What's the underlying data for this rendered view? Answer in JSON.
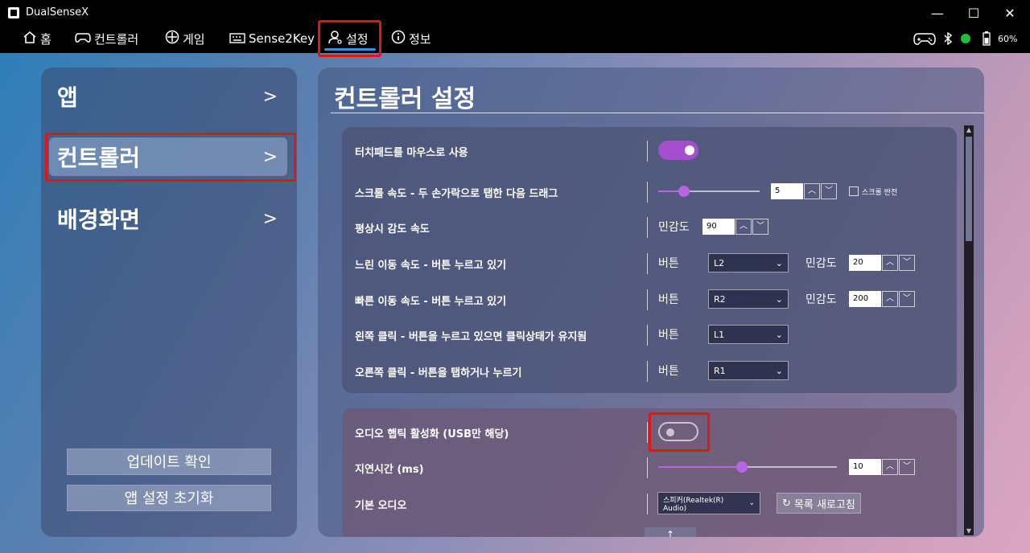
{
  "app": {
    "title": "DualSenseX"
  },
  "window": {
    "minimize": "—",
    "maximize": "☐",
    "close": "✕"
  },
  "nav": {
    "items": [
      {
        "label": "홈",
        "icon": "home-icon"
      },
      {
        "label": "컨트롤러",
        "icon": "gamepad-icon"
      },
      {
        "label": "게임",
        "icon": "games-icon"
      },
      {
        "label": "Sense2Key",
        "icon": "keyboard-icon"
      },
      {
        "label": "설정",
        "icon": "user-settings-icon",
        "active": true
      },
      {
        "label": "정보",
        "icon": "info-icon"
      }
    ],
    "battery": "60%"
  },
  "sidebar": {
    "items": [
      {
        "label": "앱",
        "chevron": ">"
      },
      {
        "label": "컨트롤러",
        "chevron": ">",
        "active": true
      },
      {
        "label": "배경화면",
        "chevron": ">"
      }
    ],
    "update_button": "업데이트 확인",
    "reset_button": "앱 설정 초기화"
  },
  "main": {
    "title": "컨트롤러 설정",
    "touchpad_mouse": {
      "label": "터치패드를 마우스로 사용",
      "enabled": true
    },
    "scroll_speed": {
      "label": "스크롤 속도 - 두 손가락으로 탭한 다음 드래그",
      "value": "5",
      "level": 0.25,
      "invert_label": "스크롤 반전",
      "invert_checked": false
    },
    "normal_sensitivity": {
      "label": "평상시 감도 속도",
      "sens_label": "민감도",
      "value": "90"
    },
    "slow_move": {
      "label": "느린 이동 속도 - 버튼 누르고 있기",
      "button_label": "버튼",
      "button_value": "L2",
      "sens_label": "민감도",
      "sens_value": "20"
    },
    "fast_move": {
      "label": "빠른 이동 속도 - 버튼 누르고 있기",
      "button_label": "버튼",
      "button_value": "R2",
      "sens_label": "민감도",
      "sens_value": "200"
    },
    "left_click": {
      "label": "왼쪽 클릭 - 버튼을 누르고 있으면 클릭상태가 유지됨",
      "button_label": "버튼",
      "button_value": "L1"
    },
    "right_click": {
      "label": "오른쪽 클릭 - 버튼을 탭하거나 누르기",
      "button_label": "버튼",
      "button_value": "R1"
    },
    "audio_haptics": {
      "label": "오디오 햅틱 활성화 (USB만 해당)",
      "enabled": false
    },
    "latency": {
      "label": "지연시간 (ms)",
      "value": "10",
      "level": 0.47
    },
    "default_audio": {
      "label": "기본 오디오",
      "value": "스피커(Realtek(R) Audio)",
      "refresh_label": "목록 새로고침"
    },
    "up_arrow": "↑"
  },
  "colors": {
    "accent": "#a64fce",
    "highlight": "#e01616",
    "battery_ok": "#1fbf3b"
  }
}
